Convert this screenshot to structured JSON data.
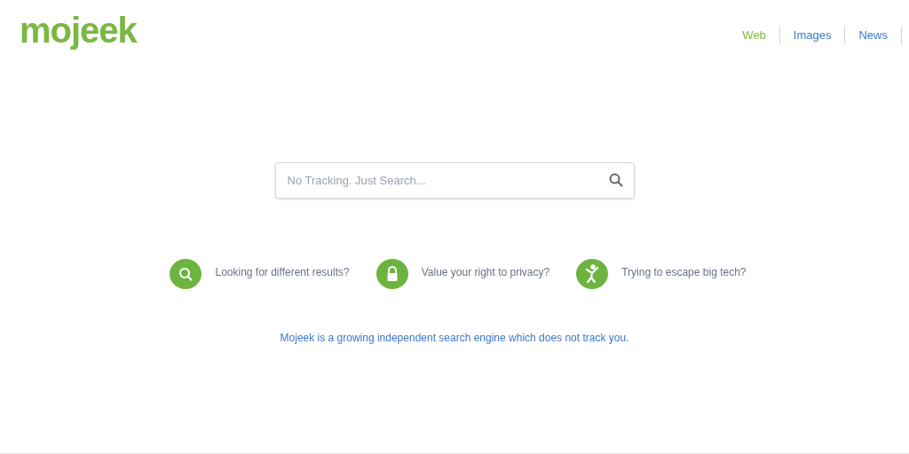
{
  "logo": "mojeek",
  "nav": [
    {
      "label": "Web",
      "selected": true
    },
    {
      "label": "Images",
      "selected": false
    },
    {
      "label": "News",
      "selected": false
    }
  ],
  "search": {
    "placeholder": "No Tracking. Just Search..."
  },
  "features": [
    {
      "kind": "search",
      "text": "Looking for different results?"
    },
    {
      "kind": "lock",
      "text": "Value your right to privacy?"
    },
    {
      "kind": "escape",
      "text": "Trying to escape big tech?"
    }
  ],
  "tagline": "Mojeek is a growing independent search engine which does not track you."
}
